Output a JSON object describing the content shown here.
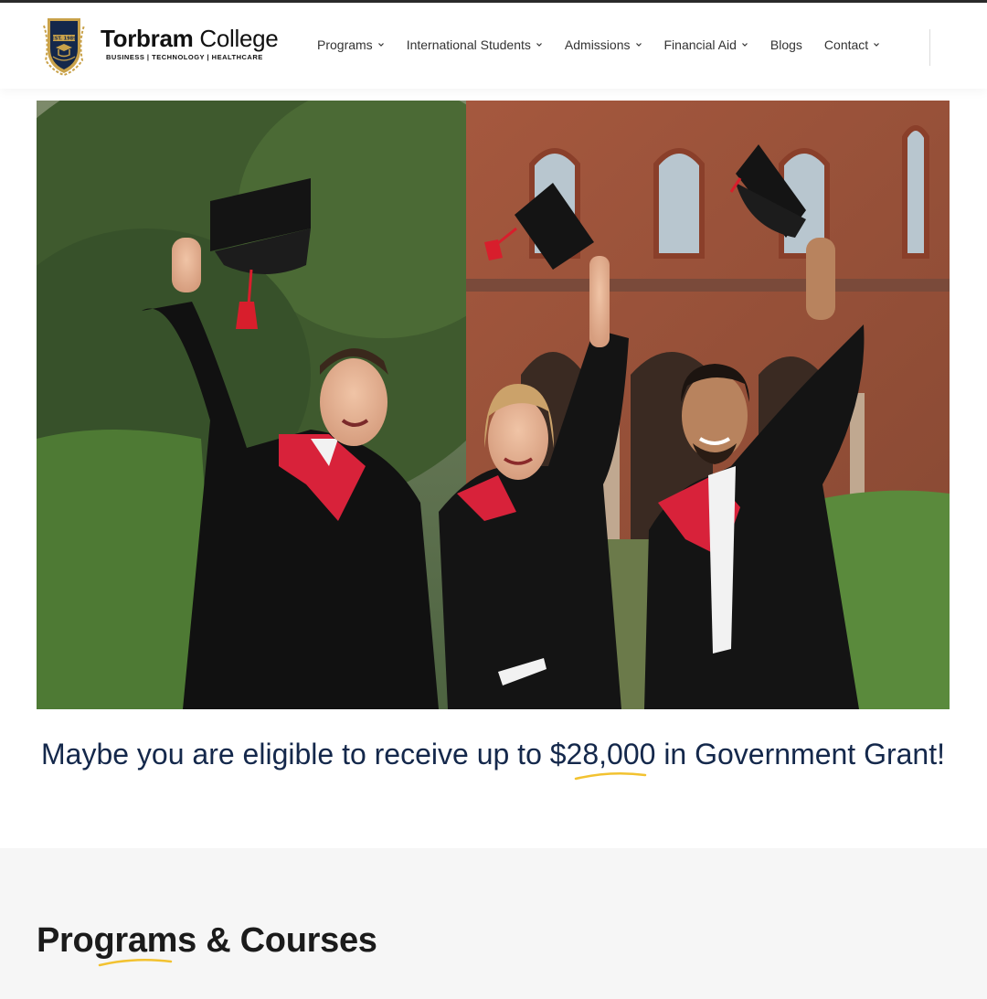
{
  "brand": {
    "name_bold": "Torbram",
    "name_light": "College",
    "tagline": "BUSINESS | TECHNOLOGY | HEALTHCARE",
    "crest_text": "EST. 1989",
    "colors": {
      "navy": "#14284b",
      "gold": "#c9a24a"
    }
  },
  "nav": {
    "items": [
      {
        "label": "Programs",
        "dropdown": true
      },
      {
        "label": "International Students",
        "dropdown": true
      },
      {
        "label": "Admissions",
        "dropdown": true
      },
      {
        "label": "Financial Aid",
        "dropdown": true
      },
      {
        "label": "Blogs",
        "dropdown": false
      },
      {
        "label": "Contact",
        "dropdown": true
      }
    ]
  },
  "hero": {
    "image_subject": "graduates-throwing-caps-photo"
  },
  "grant": {
    "pre": "Maybe you are eligible to receive up to ",
    "amount": "$28,000",
    "post": " in Government Grant!",
    "accent_color": "#f2c230"
  },
  "programs": {
    "heading": "Programs & Courses",
    "accent_color": "#f2c230"
  }
}
